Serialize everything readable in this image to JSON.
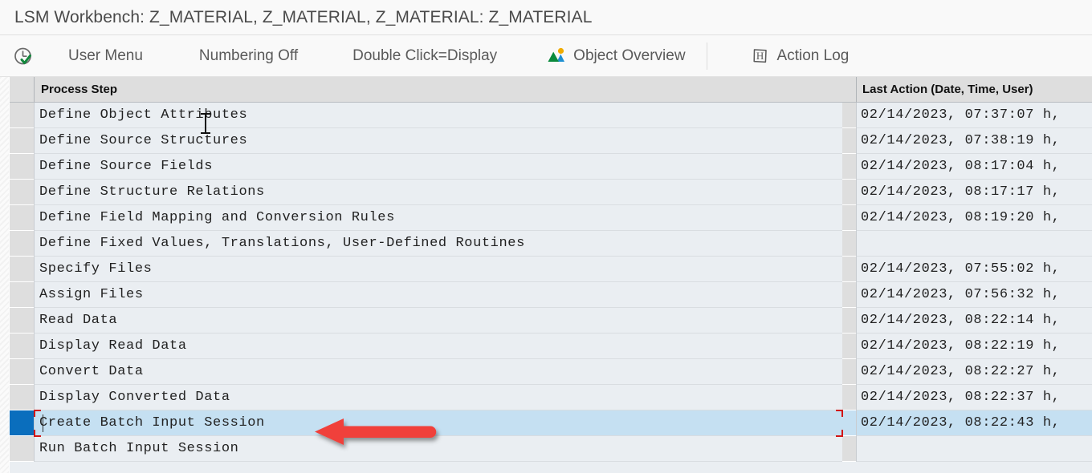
{
  "window": {
    "title": "LSM Workbench: Z_MATERIAL, Z_MATERIAL, Z_MATERIAL: Z_MATERIAL"
  },
  "toolbar": {
    "history_icon": "clock-check-icon",
    "items": [
      {
        "label": "User Menu",
        "icon": ""
      },
      {
        "label": "Numbering Off",
        "icon": ""
      },
      {
        "label": "Double Click=Display",
        "icon": ""
      },
      {
        "label": "Object Overview",
        "icon": "image-mountain-icon"
      },
      {
        "label": "Action Log",
        "icon": "h-box-icon"
      }
    ]
  },
  "table": {
    "columns": [
      {
        "key": "step",
        "label": "Process Step"
      },
      {
        "key": "action",
        "label": "Last Action (Date, Time, User)"
      }
    ],
    "rows": [
      {
        "step": "Define Object Attributes",
        "action": "02/14/2023, 07:37:07 h,"
      },
      {
        "step": "Define Source Structures",
        "action": "02/14/2023, 07:38:19 h,"
      },
      {
        "step": "Define Source Fields",
        "action": "02/14/2023, 08:17:04 h,"
      },
      {
        "step": "Define Structure Relations",
        "action": "02/14/2023, 08:17:17 h,"
      },
      {
        "step": "Define Field Mapping and Conversion Rules",
        "action": "02/14/2023, 08:19:20 h,"
      },
      {
        "step": "Define Fixed Values, Translations, User-Defined Routines",
        "action": ""
      },
      {
        "step": "Specify Files",
        "action": "02/14/2023, 07:55:02 h,"
      },
      {
        "step": "Assign Files",
        "action": "02/14/2023, 07:56:32 h,"
      },
      {
        "step": "Read Data",
        "action": "02/14/2023, 08:22:14 h,"
      },
      {
        "step": "Display Read Data",
        "action": "02/14/2023, 08:22:19 h,"
      },
      {
        "step": "Convert Data",
        "action": "02/14/2023, 08:22:27 h,"
      },
      {
        "step": "Display Converted Data",
        "action": "02/14/2023, 08:22:37 h,"
      },
      {
        "step": "Create Batch Input Session",
        "action": "02/14/2023, 08:22:43 h,"
      },
      {
        "step": "Run Batch Input Session",
        "action": ""
      }
    ],
    "selected_row_index": 12
  },
  "annotation": {
    "arrow": "red-left-arrow",
    "cursor": "text-ibeam-cursor"
  },
  "colors": {
    "selection_blue": "#c5e0f2",
    "gutter_selected": "#0a6ebd",
    "row_background": "#eaeef2",
    "header_background": "#dedede",
    "annotation_red": "#f0403a",
    "focus_bracket_red": "#d21616",
    "toolbar_text": "#5a5a5a"
  }
}
